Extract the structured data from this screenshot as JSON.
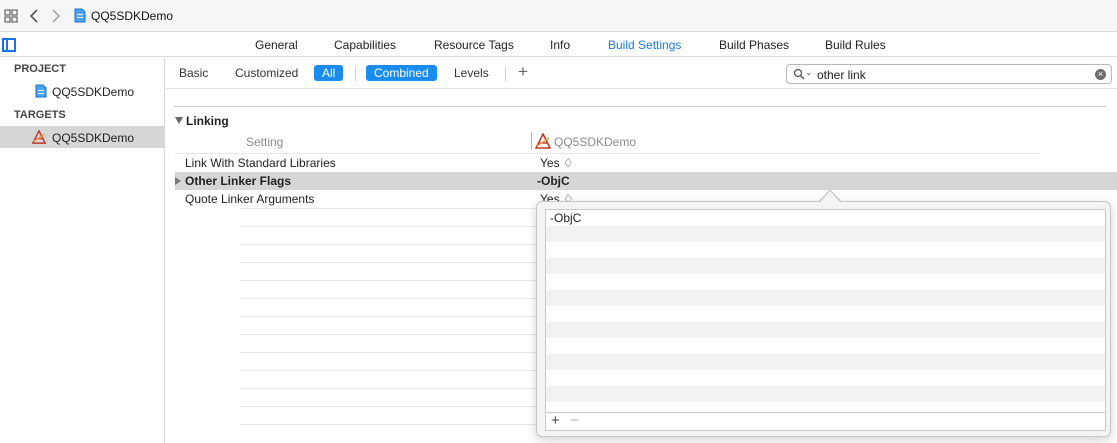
{
  "window": {
    "title": "QQ5SDKDemo"
  },
  "tabs": [
    {
      "label": "General"
    },
    {
      "label": "Capabilities"
    },
    {
      "label": "Resource Tags"
    },
    {
      "label": "Info"
    },
    {
      "label": "Build Settings",
      "active": true
    },
    {
      "label": "Build Phases"
    },
    {
      "label": "Build Rules"
    }
  ],
  "navigator": {
    "project_header": "PROJECT",
    "project_item": "QQ5SDKDemo",
    "targets_header": "TARGETS",
    "target_item": "QQ5SDKDemo"
  },
  "filterbar": {
    "basic": "Basic",
    "customized": "Customized",
    "all": "All",
    "combined": "Combined",
    "levels": "Levels",
    "add": "+",
    "search_value": "other link"
  },
  "settings": {
    "section": "Linking",
    "column_setting": "Setting",
    "column_target": "QQ5SDKDemo",
    "rows": [
      {
        "name": "Link With Standard Libraries",
        "value": "Yes ♢"
      },
      {
        "name": "Other Linker Flags",
        "value": "-ObjC"
      },
      {
        "name": "Quote Linker Arguments",
        "value": "Yes ♢"
      }
    ]
  },
  "popover": {
    "items": [
      "-ObjC"
    ],
    "add": "+",
    "remove": "−"
  },
  "colors": {
    "accent": "#1a8cf0",
    "active_tab": "#1f7ae0",
    "selection": "#d6d6d6"
  }
}
